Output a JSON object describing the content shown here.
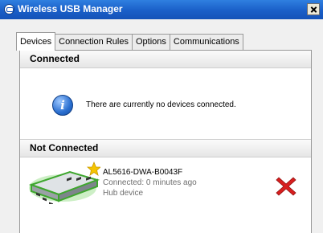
{
  "window": {
    "title": "Wireless USB Manager",
    "icon": "wireless-usb-icon",
    "close_icon": "close-icon"
  },
  "tabs": [
    {
      "label": "Devices",
      "active": true
    },
    {
      "label": "Connection Rules",
      "active": false
    },
    {
      "label": "Options",
      "active": false
    },
    {
      "label": "Communications",
      "active": false
    }
  ],
  "connected": {
    "header": "Connected",
    "empty_message": "There are currently no devices connected.",
    "icon": "info-icon"
  },
  "not_connected": {
    "header": "Not Connected",
    "devices": [
      {
        "name": "AL5616-DWA-B0043F",
        "status": "Connected: 0 minutes ago",
        "type": "Hub device",
        "icon": "usb-hub-icon",
        "badge_icon": "star-icon",
        "remove_icon": "remove-icon"
      }
    ]
  },
  "colors": {
    "titlebar": "#1a5fc8",
    "remove": "#d81e1e",
    "device_glow": "#4cc53a",
    "star": "#f5c400"
  }
}
